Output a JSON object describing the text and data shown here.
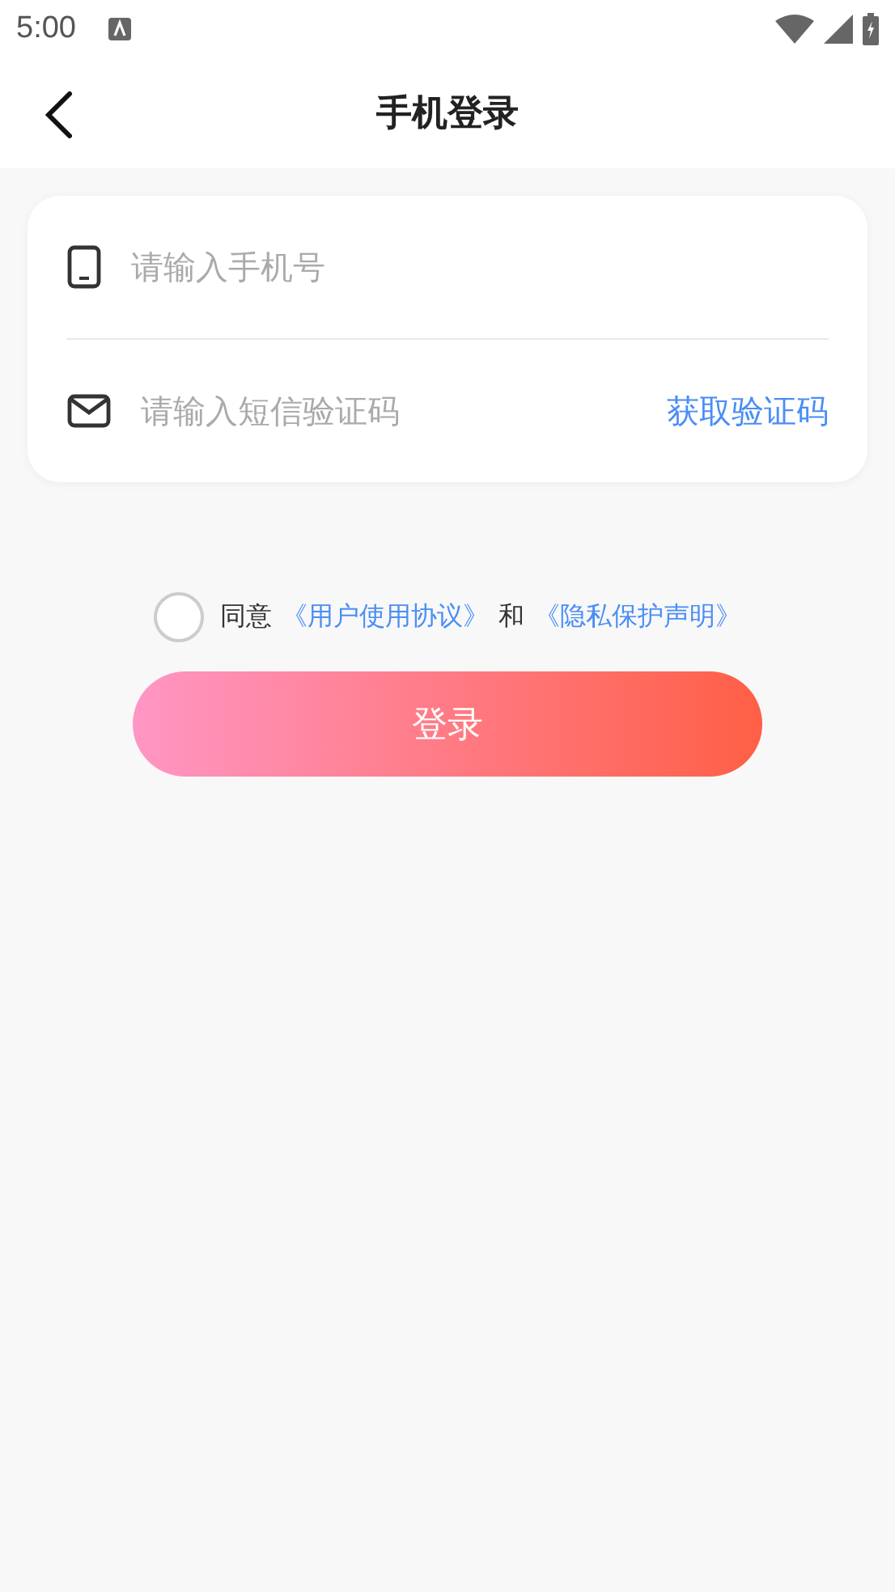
{
  "status_bar": {
    "time": "5:00"
  },
  "header": {
    "title": "手机登录"
  },
  "form": {
    "fields": [
      {
        "kind": "phone",
        "placeholder": "请输入手机号"
      },
      {
        "kind": "code",
        "placeholder": "请输入短信验证码",
        "action": "获取验证码"
      }
    ]
  },
  "agreement": {
    "checked": false,
    "prefix": "同意",
    "first_link": "《用户使用协议》",
    "conjunction": "和",
    "second_link": "《隐私保护声明》"
  },
  "login_button": {
    "label": "登录"
  }
}
